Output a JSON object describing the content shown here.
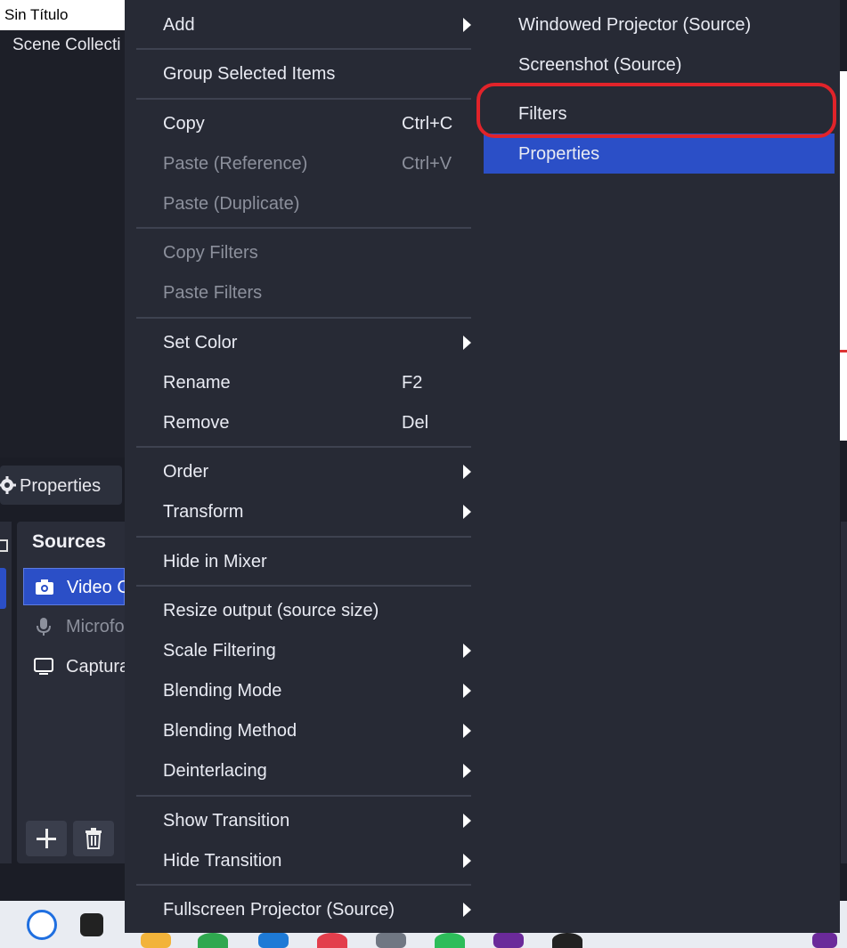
{
  "window": {
    "title": "Sin Título"
  },
  "scenes_label": "Scene Collecti",
  "properties_button": {
    "label": "Properties"
  },
  "sources": {
    "title": "Sources",
    "items": [
      {
        "label": "Video C",
        "icon": "camera-icon"
      },
      {
        "label": "Microfo",
        "icon": "microphone-icon"
      },
      {
        "label": "Captura",
        "icon": "monitor-icon"
      }
    ]
  },
  "context_menu": {
    "add": "Add",
    "group_selected": "Group Selected Items",
    "copy": "Copy",
    "copy_shortcut": "Ctrl+C",
    "paste_reference": "Paste (Reference)",
    "paste_reference_shortcut": "Ctrl+V",
    "paste_duplicate": "Paste (Duplicate)",
    "copy_filters": "Copy Filters",
    "paste_filters": "Paste Filters",
    "set_color": "Set Color",
    "rename": "Rename",
    "rename_shortcut": "F2",
    "remove": "Remove",
    "remove_shortcut": "Del",
    "order": "Order",
    "transform": "Transform",
    "hide_in_mixer": "Hide in Mixer",
    "resize_output": "Resize output (source size)",
    "scale_filtering": "Scale Filtering",
    "blending_mode": "Blending Mode",
    "blending_method": "Blending Method",
    "deinterlacing": "Deinterlacing",
    "show_transition": "Show Transition",
    "hide_transition": "Hide Transition",
    "fullscreen_projector": "Fullscreen Projector (Source)"
  },
  "submenu": {
    "windowed_projector": "Windowed Projector (Source)",
    "screenshot": "Screenshot (Source)",
    "filters": "Filters",
    "properties": "Properties"
  },
  "colors": {
    "menu_bg": "#272a35",
    "accent": "#2b4fc7",
    "highlight_ring": "#e1232a"
  }
}
